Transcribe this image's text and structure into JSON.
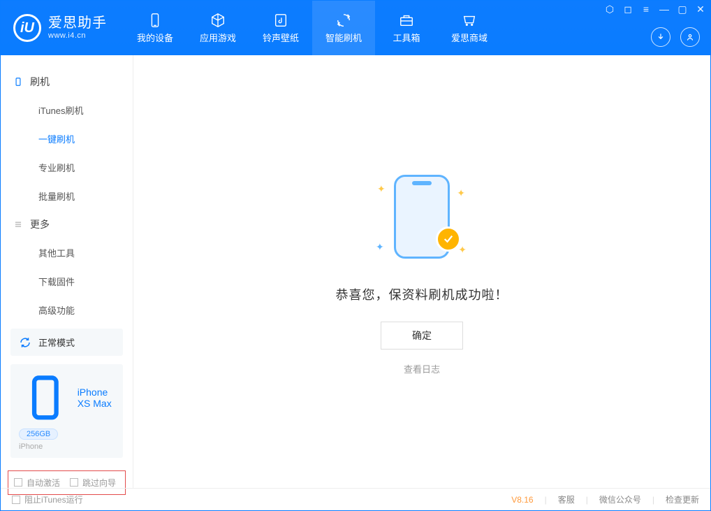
{
  "app": {
    "title": "爱思助手",
    "subtitle": "www.i4.cn"
  },
  "nav": {
    "items": [
      {
        "label": "我的设备"
      },
      {
        "label": "应用游戏"
      },
      {
        "label": "铃声壁纸"
      },
      {
        "label": "智能刷机",
        "active": true
      },
      {
        "label": "工具箱"
      },
      {
        "label": "爱思商域"
      }
    ]
  },
  "sidebar": {
    "group1_label": "刷机",
    "items1": [
      {
        "label": "iTunes刷机"
      },
      {
        "label": "一键刷机",
        "active": true
      },
      {
        "label": "专业刷机"
      },
      {
        "label": "批量刷机"
      }
    ],
    "group2_label": "更多",
    "items2": [
      {
        "label": "其他工具"
      },
      {
        "label": "下载固件"
      },
      {
        "label": "高级功能"
      }
    ],
    "mode_label": "正常模式",
    "device_name": "iPhone XS Max",
    "device_storage": "256GB",
    "device_type": "iPhone",
    "opt_auto_activate": "自动激活",
    "opt_skip_guide": "跳过向导"
  },
  "main": {
    "success_text": "恭喜您，保资料刷机成功啦！",
    "ok_button": "确定",
    "view_log": "查看日志"
  },
  "footer": {
    "block_itunes": "阻止iTunes运行",
    "version": "V8.16",
    "support": "客服",
    "wechat": "微信公众号",
    "check_update": "检查更新"
  }
}
